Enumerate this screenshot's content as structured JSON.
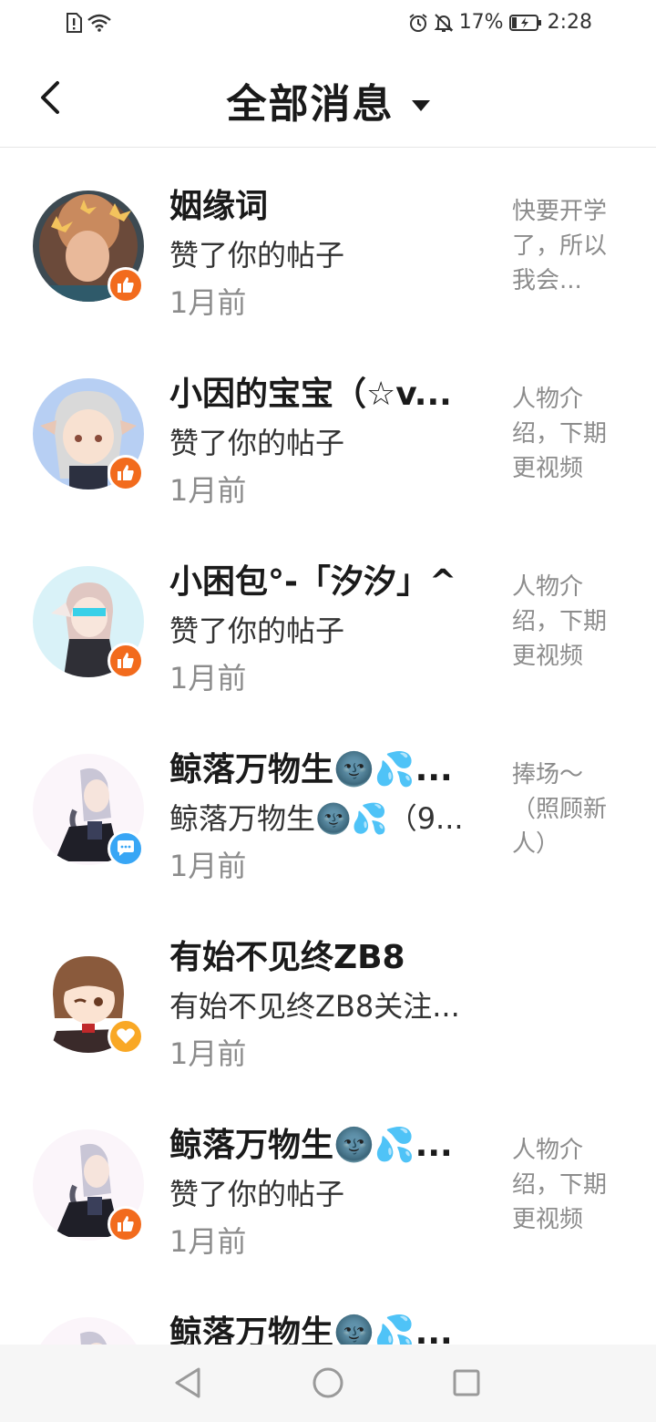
{
  "status_bar": {
    "battery_percent": "17%",
    "time": "2:28",
    "icons": [
      "sim-alert-icon",
      "wifi-icon",
      "alarm-icon",
      "mute-bell-icon",
      "battery-charging-icon"
    ]
  },
  "header": {
    "title": "全部消息",
    "back_icon": "chevron-left-icon",
    "dropdown_icon": "triangle-down-icon"
  },
  "messages": [
    {
      "name": "姻缘词",
      "action": "赞了你的帖子",
      "time": "1月前",
      "preview": "快要开学了，所以我会...",
      "badge": "like"
    },
    {
      "name": "小因的宝宝（☆v...",
      "action": "赞了你的帖子",
      "time": "1月前",
      "preview": "人物介绍，下期更视频",
      "badge": "like"
    },
    {
      "name": "小困包°-「汐汐」^",
      "action": "赞了你的帖子",
      "time": "1月前",
      "preview": "人物介绍，下期更视频",
      "badge": "like"
    },
    {
      "name": "鲸落万物生🌚💦...",
      "action": "鲸落万物生🌚💦（9...",
      "time": "1月前",
      "preview": "捧场～（照顾新人）",
      "badge": "comment"
    },
    {
      "name": "有始不见终ZB8",
      "action": "有始不见终ZB8关注...",
      "time": "1月前",
      "preview": "",
      "badge": "follow"
    },
    {
      "name": "鲸落万物生🌚💦...",
      "action": "赞了你的帖子",
      "time": "1月前",
      "preview": "人物介绍，下期更视频",
      "badge": "like"
    },
    {
      "name": "鲸落万物生🌚💦...",
      "action": "",
      "time": "",
      "preview": "",
      "badge": "like"
    }
  ],
  "nav_bar": {
    "icons": [
      "back-triangle-icon",
      "home-circle-icon",
      "recents-square-icon"
    ]
  },
  "colors": {
    "like_badge": "#f26b1d",
    "comment_badge": "#38a6f5",
    "follow_badge": "#f9a825",
    "secondary_text": "#8c8c8c"
  }
}
